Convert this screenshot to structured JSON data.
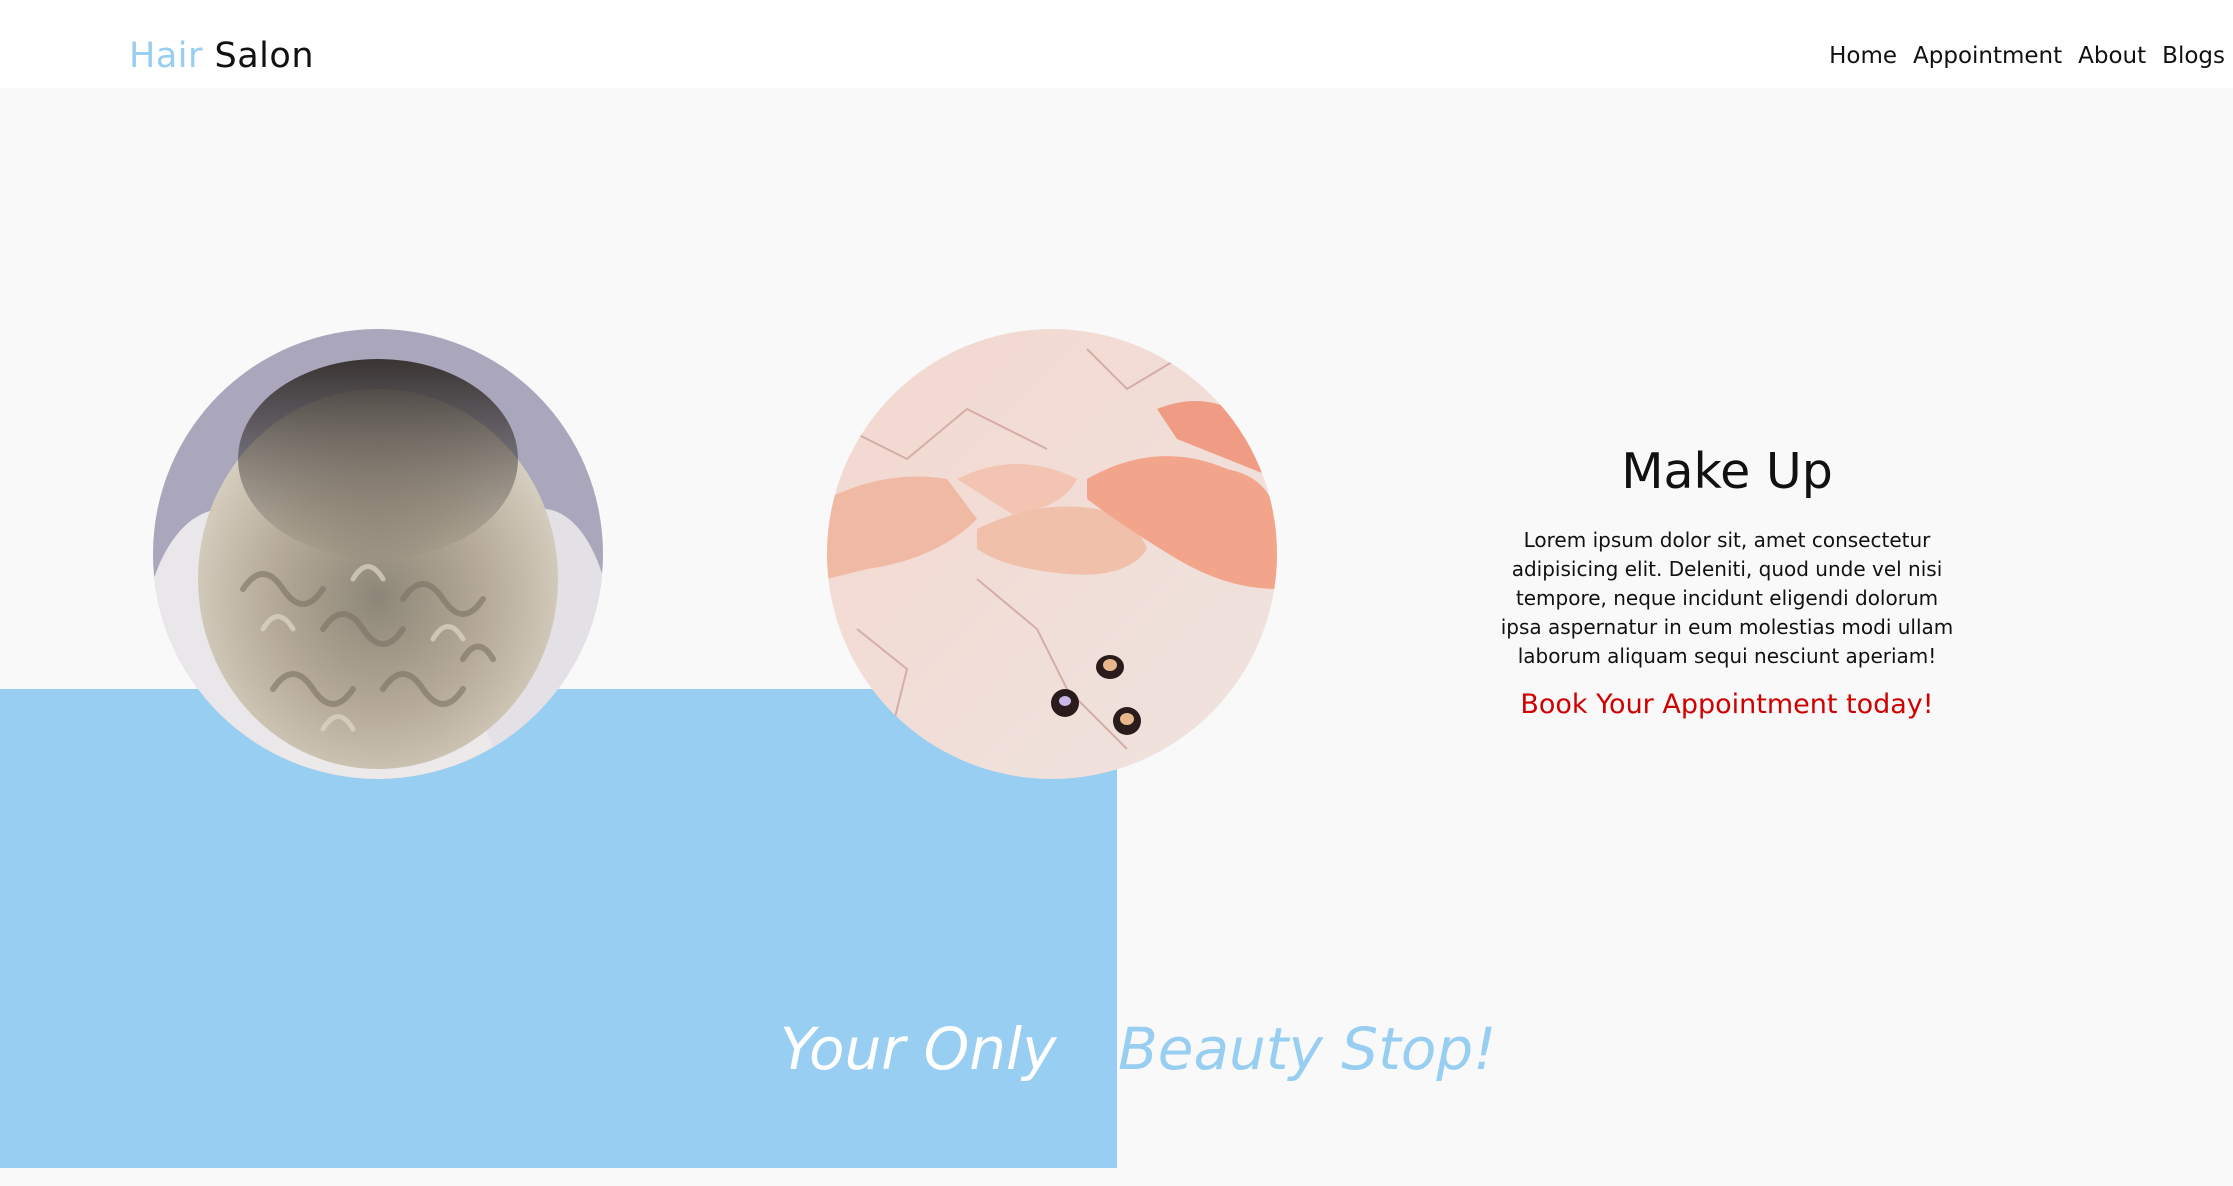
{
  "header": {
    "logo_part1": "Hair",
    "logo_part2": " Salon",
    "nav": [
      "Home",
      "Appointment",
      "About",
      "Blogs"
    ]
  },
  "images": {
    "left_circle": "curly-ombre-hair-photo",
    "right_circle": "manicure-nail-polish-photo"
  },
  "feature": {
    "title": "Make Up",
    "description": "Lorem ipsum dolor sit, amet consectetur adipisicing elit. Deleniti, quod unde vel nisi tempore, neque incidunt eligendi dolorum ipsa aspernatur in eum molestias modi ullam laborum aliquam sequi nesciunt aperiam!",
    "cta": "Book Your Appointment today!"
  },
  "tagline": {
    "left": "Your Only",
    "right": "Beauty Stop!"
  },
  "colors": {
    "accent": "#98cef1",
    "cta": "#d10000",
    "background": "#f9f9f9"
  }
}
